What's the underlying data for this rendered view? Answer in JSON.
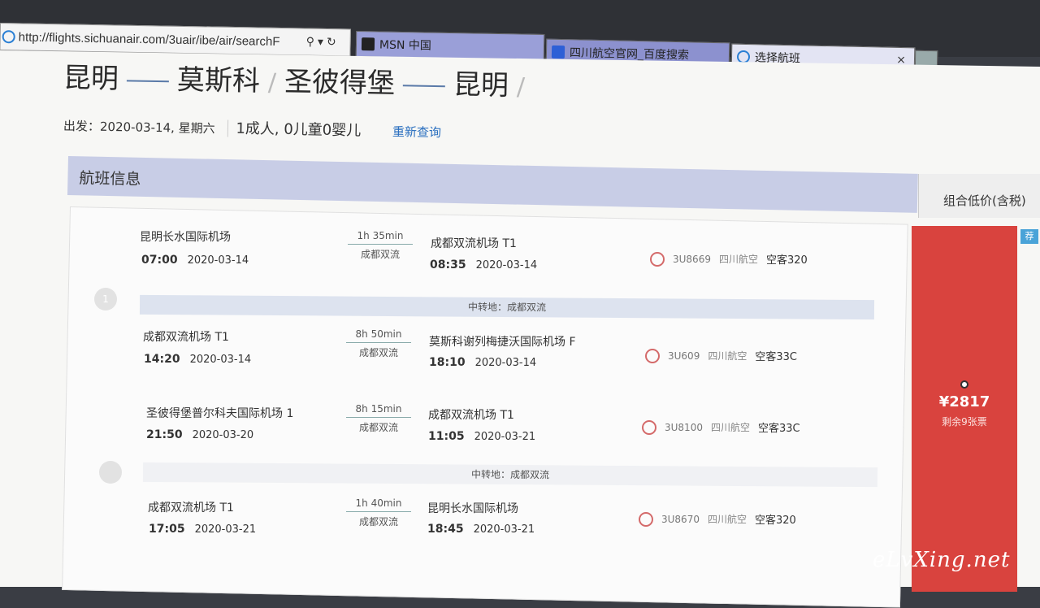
{
  "browser": {
    "url": "http://flights.sichuanair.com/3uair/ibe/air/searchF",
    "tabs": [
      {
        "label": "MSN 中国"
      },
      {
        "label": "四川航空官网_百度搜索"
      },
      {
        "label": "选择航班",
        "close": "×"
      }
    ],
    "search_glyph": "⚲",
    "dropdown_glyph": "▾",
    "refresh_glyph": "↻"
  },
  "route": {
    "leg1_from": "昆明",
    "leg1_to": "莫斯科",
    "leg2_from": "圣彼得堡",
    "leg2_to": "昆明"
  },
  "meta": {
    "departure": "出发：2020-03-14, 星期六",
    "passengers": "1成人, 0儿童0婴儿",
    "requery": "重新查询"
  },
  "header": {
    "title": "航班信息",
    "combo_price": "组合低价(含税)"
  },
  "trip_markers": [
    "1",
    ""
  ],
  "segments": [
    {
      "dep_airport": "昆明长水国际机场",
      "dep_time": "07:00",
      "dep_date": "2020-03-14",
      "duration": "1h 35min",
      "via": "成都双流",
      "arr_airport": "成都双流机场  T1",
      "arr_time": "08:35",
      "arr_date": "2020-03-14",
      "flight_no": "3U8669",
      "airline": "四川航空",
      "aircraft": "空客320"
    },
    {
      "dep_airport": "成都双流机场  T1",
      "dep_time": "14:20",
      "dep_date": "2020-03-14",
      "duration": "8h 50min",
      "via": "成都双流",
      "arr_airport": "莫斯科谢列梅捷沃国际机场  F",
      "arr_time": "18:10",
      "arr_date": "2020-03-14",
      "flight_no": "3U609",
      "airline": "四川航空",
      "aircraft": "空客33C"
    },
    {
      "dep_airport": "圣彼得堡普尔科夫国际机场  1",
      "dep_time": "21:50",
      "dep_date": "2020-03-20",
      "duration": "8h 15min",
      "via": "成都双流",
      "arr_airport": "成都双流机场  T1",
      "arr_time": "11:05",
      "arr_date": "2020-03-21",
      "flight_no": "3U8100",
      "airline": "四川航空",
      "aircraft": "空客33C"
    },
    {
      "dep_airport": "成都双流机场  T1",
      "dep_time": "17:05",
      "dep_date": "2020-03-21",
      "duration": "1h 40min",
      "via": "成都双流",
      "arr_airport": "昆明长水国际机场",
      "arr_time": "18:45",
      "arr_date": "2020-03-21",
      "flight_no": "3U8670",
      "airline": "四川航空",
      "aircraft": "空客320"
    }
  ],
  "transfers": [
    "中转地：成都双流",
    "中转地：成都双流"
  ],
  "price": {
    "amount": "¥2817",
    "seats_left": "剩余9张票",
    "badge": "荐"
  },
  "watermark": "eLvXing.net",
  "colors": {
    "price_bg": "#d9433e",
    "header_bg": "#c8cde6",
    "link": "#2a6fbf"
  }
}
